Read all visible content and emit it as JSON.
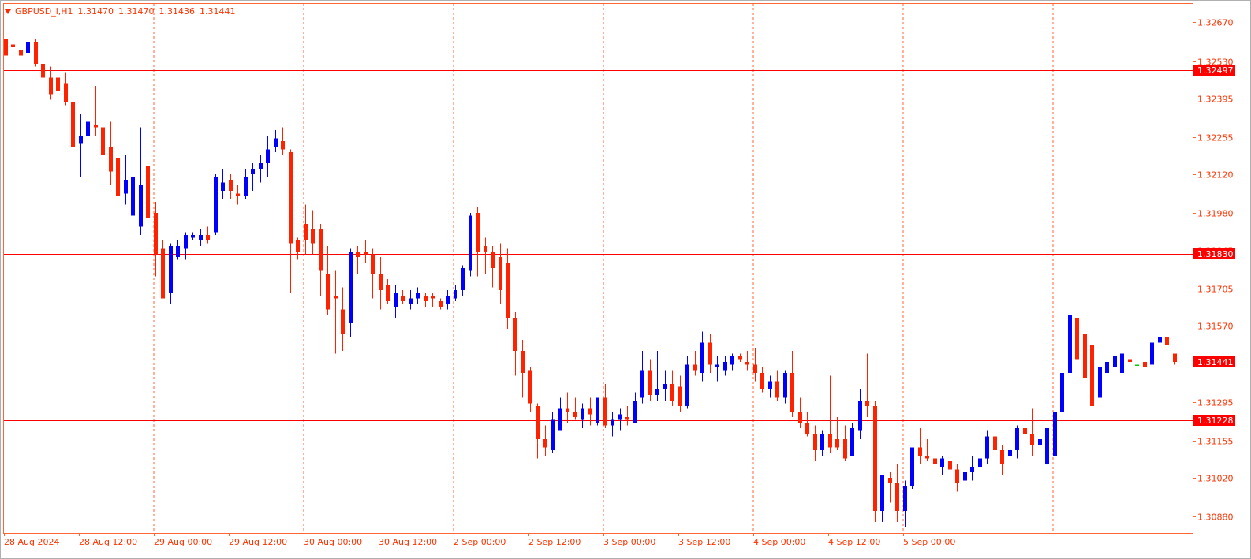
{
  "header": {
    "symbol": "GBPUSD_i,H1",
    "ohlc": [
      "1.31470",
      "1.31470",
      "1.31436",
      "1.31441"
    ]
  },
  "colors": {
    "background": "#ffffff",
    "frame": "#ff6633",
    "text": "#ff3300",
    "grid": "#ff6633",
    "bull": "#0000ff",
    "bear": "#ff2200",
    "doji": "#00cc00",
    "level_line": "#ff0000",
    "label_bg": "#ff0000",
    "label_text": "#ffffff"
  },
  "chart_data": {
    "type": "candlestick",
    "timeframe": "H1",
    "ylim": [
      1.3082,
      1.3274
    ],
    "price_ticks": [
      "1.32670",
      "1.32530",
      "1.32395",
      "1.32255",
      "1.32120",
      "1.31980",
      "1.31845",
      "1.31705",
      "1.31570",
      "1.31435",
      "1.31295",
      "1.31155",
      "1.31020",
      "1.30880"
    ],
    "time_labels": [
      "28 Aug 2024",
      "28 Aug 12:00",
      "29 Aug 00:00",
      "29 Aug 12:00",
      "30 Aug 00:00",
      "30 Aug 12:00",
      "2 Sep 00:00",
      "2 Sep 12:00",
      "3 Sep 00:00",
      "3 Sep 12:00",
      "4 Sep 00:00",
      "4 Sep 12:00",
      "5 Sep 00:00"
    ],
    "horizontal_levels": [
      {
        "price": 1.32497,
        "label": "1.32497"
      },
      {
        "price": 1.3183,
        "label": "1.31830"
      },
      {
        "price": 1.31228,
        "label": "1.31228"
      }
    ],
    "current_price": {
      "price": 1.31441,
      "label": "1.31441"
    },
    "candles": [
      [
        1.3261,
        1.3263,
        1.3254,
        1.3255
      ],
      [
        1.3259,
        1.3262,
        1.3256,
        1.3258
      ],
      [
        1.3257,
        1.3258,
        1.3253,
        1.3255
      ],
      [
        1.3256,
        1.3261,
        1.3255,
        1.326
      ],
      [
        1.326,
        1.3261,
        1.3251,
        1.3252
      ],
      [
        1.3252,
        1.3254,
        1.3244,
        1.3247
      ],
      [
        1.3247,
        1.3251,
        1.3239,
        1.3241
      ],
      [
        1.3247,
        1.325,
        1.3237,
        1.3242
      ],
      [
        1.3245,
        1.3249,
        1.3237,
        1.3238
      ],
      [
        1.3238,
        1.3239,
        1.3217,
        1.3222
      ],
      [
        1.3223,
        1.3234,
        1.3211,
        1.3226
      ],
      [
        1.3226,
        1.3244,
        1.3222,
        1.3231
      ],
      [
        1.323,
        1.3244,
        1.3226,
        1.3229
      ],
      [
        1.3229,
        1.3236,
        1.3211,
        1.3219
      ],
      [
        1.3222,
        1.3231,
        1.3208,
        1.3213
      ],
      [
        1.3218,
        1.3221,
        1.3202,
        1.3204
      ],
      [
        1.3205,
        1.3219,
        1.3201,
        1.321
      ],
      [
        1.3197,
        1.3212,
        1.3194,
        1.3211
      ],
      [
        1.3193,
        1.3229,
        1.319,
        1.3208
      ],
      [
        1.3215,
        1.3216,
        1.3186,
        1.3196
      ],
      [
        1.3198,
        1.3202,
        1.3175,
        1.3183
      ],
      [
        1.3185,
        1.3188,
        1.3167,
        1.3167
      ],
      [
        1.3169,
        1.3187,
        1.3165,
        1.3186
      ],
      [
        1.3182,
        1.3188,
        1.3181,
        1.3186
      ],
      [
        1.3185,
        1.3191,
        1.3181,
        1.319
      ],
      [
        1.3189,
        1.3191,
        1.3188,
        1.319
      ],
      [
        1.3188,
        1.3192,
        1.3186,
        1.319
      ],
      [
        1.319,
        1.3193,
        1.3187,
        1.3188
      ],
      [
        1.3191,
        1.3212,
        1.319,
        1.3211
      ],
      [
        1.3206,
        1.3214,
        1.3203,
        1.3209
      ],
      [
        1.321,
        1.3212,
        1.3203,
        1.3206
      ],
      [
        1.3205,
        1.3208,
        1.3201,
        1.3204
      ],
      [
        1.3204,
        1.3214,
        1.3203,
        1.3211
      ],
      [
        1.3212,
        1.3216,
        1.3206,
        1.3214
      ],
      [
        1.3214,
        1.3219,
        1.3209,
        1.3216
      ],
      [
        1.3216,
        1.3226,
        1.3211,
        1.3221
      ],
      [
        1.3222,
        1.3228,
        1.322,
        1.3225
      ],
      [
        1.3224,
        1.3229,
        1.3219,
        1.3221
      ],
      [
        1.322,
        1.3221,
        1.3169,
        1.3187
      ],
      [
        1.3188,
        1.3189,
        1.3181,
        1.3184
      ],
      [
        1.3194,
        1.3201,
        1.3183,
        1.3188
      ],
      [
        1.3192,
        1.3199,
        1.3183,
        1.3187
      ],
      [
        1.3192,
        1.3194,
        1.3168,
        1.3177
      ],
      [
        1.3176,
        1.3186,
        1.3161,
        1.3163
      ],
      [
        1.3168,
        1.3177,
        1.3147,
        1.3167
      ],
      [
        1.3163,
        1.3171,
        1.3148,
        1.3154
      ],
      [
        1.3158,
        1.3185,
        1.3153,
        1.3184
      ],
      [
        1.3184,
        1.3186,
        1.3176,
        1.3182
      ],
      [
        1.3184,
        1.3188,
        1.318,
        1.3183
      ],
      [
        1.3183,
        1.3185,
        1.3167,
        1.3176
      ],
      [
        1.3176,
        1.3182,
        1.3163,
        1.317
      ],
      [
        1.3172,
        1.3174,
        1.3165,
        1.3166
      ],
      [
        1.3164,
        1.3172,
        1.316,
        1.3169
      ],
      [
        1.3168,
        1.317,
        1.3165,
        1.3166
      ],
      [
        1.3165,
        1.317,
        1.3163,
        1.3167
      ],
      [
        1.3167,
        1.3171,
        1.3165,
        1.3169
      ],
      [
        1.3168,
        1.3169,
        1.3164,
        1.3166
      ],
      [
        1.3168,
        1.3169,
        1.3164,
        1.3167
      ],
      [
        1.3166,
        1.3167,
        1.3163,
        1.3164
      ],
      [
        1.3165,
        1.317,
        1.3163,
        1.3168
      ],
      [
        1.3167,
        1.3172,
        1.3166,
        1.317
      ],
      [
        1.317,
        1.3179,
        1.3168,
        1.3178
      ],
      [
        1.3177,
        1.3198,
        1.3175,
        1.3197
      ],
      [
        1.3198,
        1.32,
        1.3175,
        1.3184
      ],
      [
        1.3186,
        1.3189,
        1.3176,
        1.3184
      ],
      [
        1.3184,
        1.3186,
        1.3171,
        1.3178
      ],
      [
        1.3182,
        1.3187,
        1.3165,
        1.317
      ],
      [
        1.318,
        1.3185,
        1.3156,
        1.316
      ],
      [
        1.316,
        1.3162,
        1.3139,
        1.3148
      ],
      [
        1.3148,
        1.3152,
        1.3131,
        1.314
      ],
      [
        1.3141,
        1.3142,
        1.3126,
        1.3129
      ],
      [
        1.3128,
        1.3129,
        1.3109,
        1.3116
      ],
      [
        1.3116,
        1.3121,
        1.311,
        1.3113
      ],
      [
        1.3112,
        1.3126,
        1.3111,
        1.3123
      ],
      [
        1.3119,
        1.3131,
        1.3119,
        1.3127
      ],
      [
        1.3127,
        1.3133,
        1.3122,
        1.3126
      ],
      [
        1.3126,
        1.3131,
        1.3123,
        1.3124
      ],
      [
        1.3123,
        1.3129,
        1.312,
        1.3127
      ],
      [
        1.3127,
        1.3131,
        1.3121,
        1.3125
      ],
      [
        1.3122,
        1.3131,
        1.3121,
        1.3131
      ],
      [
        1.3131,
        1.3136,
        1.312,
        1.3121
      ],
      [
        1.3121,
        1.3126,
        1.3117,
        1.3123
      ],
      [
        1.3123,
        1.3127,
        1.3119,
        1.3125
      ],
      [
        1.3124,
        1.3128,
        1.3121,
        1.3123
      ],
      [
        1.3122,
        1.3133,
        1.3122,
        1.313
      ],
      [
        1.3131,
        1.3148,
        1.3129,
        1.3141
      ],
      [
        1.3141,
        1.3145,
        1.313,
        1.3132
      ],
      [
        1.3132,
        1.3148,
        1.313,
        1.3134
      ],
      [
        1.3134,
        1.3141,
        1.313,
        1.3136
      ],
      [
        1.3136,
        1.3141,
        1.3128,
        1.313
      ],
      [
        1.3135,
        1.3139,
        1.3126,
        1.3128
      ],
      [
        1.3128,
        1.3146,
        1.3127,
        1.3143
      ],
      [
        1.3143,
        1.3148,
        1.3139,
        1.3141
      ],
      [
        1.314,
        1.3155,
        1.3137,
        1.3151
      ],
      [
        1.3151,
        1.3154,
        1.314,
        1.3143
      ],
      [
        1.3142,
        1.3146,
        1.3137,
        1.3143
      ],
      [
        1.3141,
        1.3146,
        1.3139,
        1.3144
      ],
      [
        1.3143,
        1.3147,
        1.3141,
        1.3146
      ],
      [
        1.3146,
        1.3147,
        1.3144,
        1.3145
      ],
      [
        1.3144,
        1.3148,
        1.3141,
        1.3143
      ],
      [
        1.3143,
        1.3149,
        1.3137,
        1.314
      ],
      [
        1.314,
        1.3142,
        1.3133,
        1.3134
      ],
      [
        1.3134,
        1.3139,
        1.3131,
        1.3137
      ],
      [
        1.3137,
        1.3141,
        1.313,
        1.3131
      ],
      [
        1.3131,
        1.3141,
        1.3129,
        1.314
      ],
      [
        1.314,
        1.3148,
        1.3124,
        1.3126
      ],
      [
        1.3126,
        1.3131,
        1.312,
        1.3122
      ],
      [
        1.3122,
        1.3126,
        1.3117,
        1.3118
      ],
      [
        1.3118,
        1.3121,
        1.3108,
        1.3112
      ],
      [
        1.3112,
        1.3119,
        1.311,
        1.3118
      ],
      [
        1.3118,
        1.3139,
        1.3111,
        1.3113
      ],
      [
        1.3116,
        1.3124,
        1.3112,
        1.3113
      ],
      [
        1.3116,
        1.3121,
        1.3108,
        1.3109
      ],
      [
        1.311,
        1.3122,
        1.311,
        1.312
      ],
      [
        1.3119,
        1.3134,
        1.3116,
        1.313
      ],
      [
        1.313,
        1.3147,
        1.3124,
        1.3128
      ],
      [
        1.3128,
        1.313,
        1.3086,
        1.309
      ],
      [
        1.309,
        1.3101,
        1.3086,
        1.3103
      ],
      [
        1.3102,
        1.3104,
        1.3093,
        1.31
      ],
      [
        1.31,
        1.3107,
        1.3086,
        1.309
      ],
      [
        1.309,
        1.3101,
        1.3084,
        1.3099
      ],
      [
        1.3099,
        1.3112,
        1.3098,
        1.3113
      ],
      [
        1.3113,
        1.312,
        1.3107,
        1.311
      ],
      [
        1.311,
        1.3116,
        1.3108,
        1.3109
      ],
      [
        1.3109,
        1.3111,
        1.3101,
        1.3107
      ],
      [
        1.3106,
        1.311,
        1.3103,
        1.3109
      ],
      [
        1.3108,
        1.3113,
        1.3105,
        1.3105
      ],
      [
        1.3105,
        1.3107,
        1.3097,
        1.31
      ],
      [
        1.3101,
        1.3107,
        1.3098,
        1.3104
      ],
      [
        1.3104,
        1.311,
        1.3101,
        1.3106
      ],
      [
        1.3106,
        1.3114,
        1.3104,
        1.3109
      ],
      [
        1.3109,
        1.3119,
        1.3107,
        1.3117
      ],
      [
        1.3117,
        1.312,
        1.3109,
        1.3112
      ],
      [
        1.3112,
        1.3114,
        1.3103,
        1.3107
      ],
      [
        1.311,
        1.3116,
        1.31,
        1.3112
      ],
      [
        1.3112,
        1.3121,
        1.3109,
        1.312
      ],
      [
        1.312,
        1.3128,
        1.3107,
        1.3118
      ],
      [
        1.3118,
        1.3127,
        1.311,
        1.3114
      ],
      [
        1.3114,
        1.3119,
        1.311,
        1.3116
      ],
      [
        1.3107,
        1.3122,
        1.3106,
        1.312
      ],
      [
        1.311,
        1.3126,
        1.3106,
        1.3126
      ],
      [
        1.3126,
        1.314,
        1.3124,
        1.314
      ],
      [
        1.314,
        1.3177,
        1.3138,
        1.3161
      ],
      [
        1.316,
        1.3162,
        1.3145,
        1.3145
      ],
      [
        1.3154,
        1.3156,
        1.3134,
        1.3138
      ],
      [
        1.315,
        1.3154,
        1.3132,
        1.3128
      ],
      [
        1.3131,
        1.3143,
        1.3128,
        1.3142
      ],
      [
        1.314,
        1.3148,
        1.3138,
        1.3144
      ],
      [
        1.3142,
        1.3149,
        1.314,
        1.3146
      ],
      [
        1.314,
        1.3149,
        1.314,
        1.3147
      ],
      [
        1.3145,
        1.3149,
        1.314,
        1.3144
      ],
      [
        1.3143,
        1.3147,
        1.314,
        1.3143
      ],
      [
        1.3144,
        1.3146,
        1.314,
        1.3142
      ],
      [
        1.3143,
        1.3155,
        1.3142,
        1.3151
      ],
      [
        1.3151,
        1.3155,
        1.3149,
        1.3153
      ],
      [
        1.3153,
        1.3155,
        1.3147,
        1.315
      ],
      [
        1.3147,
        1.3147,
        1.3143,
        1.3144
      ]
    ]
  }
}
